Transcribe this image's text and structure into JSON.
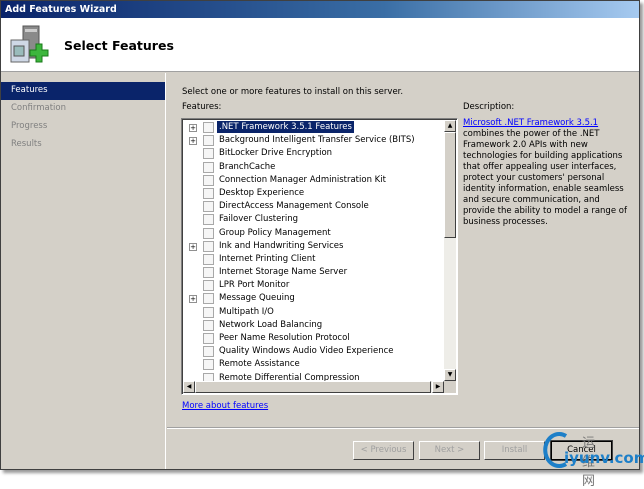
{
  "window": {
    "title": "Add Features Wizard"
  },
  "header": {
    "title": "Select Features"
  },
  "sidebar": {
    "items": [
      {
        "label": "Features",
        "selected": true
      },
      {
        "label": "Confirmation"
      },
      {
        "label": "Progress"
      },
      {
        "label": "Results"
      }
    ]
  },
  "main": {
    "intro": "Select one or more features to install on this server.",
    "features_label": "Features:",
    "features": [
      {
        "label": ".NET Framework 3.5.1 Features",
        "expandable": true,
        "selected": true
      },
      {
        "label": "Background Intelligent Transfer Service (BITS)",
        "expandable": true
      },
      {
        "label": "BitLocker Drive Encryption"
      },
      {
        "label": "BranchCache"
      },
      {
        "label": "Connection Manager Administration Kit"
      },
      {
        "label": "Desktop Experience"
      },
      {
        "label": "DirectAccess Management Console"
      },
      {
        "label": "Failover Clustering"
      },
      {
        "label": "Group Policy Management"
      },
      {
        "label": "Ink and Handwriting Services",
        "expandable": true
      },
      {
        "label": "Internet Printing Client"
      },
      {
        "label": "Internet Storage Name Server"
      },
      {
        "label": "LPR Port Monitor"
      },
      {
        "label": "Message Queuing",
        "expandable": true
      },
      {
        "label": "Multipath I/O"
      },
      {
        "label": "Network Load Balancing"
      },
      {
        "label": "Peer Name Resolution Protocol"
      },
      {
        "label": "Quality Windows Audio Video Experience"
      },
      {
        "label": "Remote Assistance"
      },
      {
        "label": "Remote Differential Compression"
      }
    ],
    "more_link": "More about features",
    "description": {
      "title": "Description:",
      "link": "Microsoft .NET Framework 3.5.1",
      "text": " combines the power of the .NET Framework 2.0 APIs with new technologies for building applications that offer appealing user interfaces, protect your customers' personal identity information, enable seamless and secure communication, and provide the ability to model a range of business processes."
    }
  },
  "buttons": {
    "previous": "< Previous",
    "next": "Next >",
    "install": "Install",
    "cancel": "Cancel"
  },
  "watermark": {
    "cn": "运维网",
    "url": "iyunv.com"
  }
}
